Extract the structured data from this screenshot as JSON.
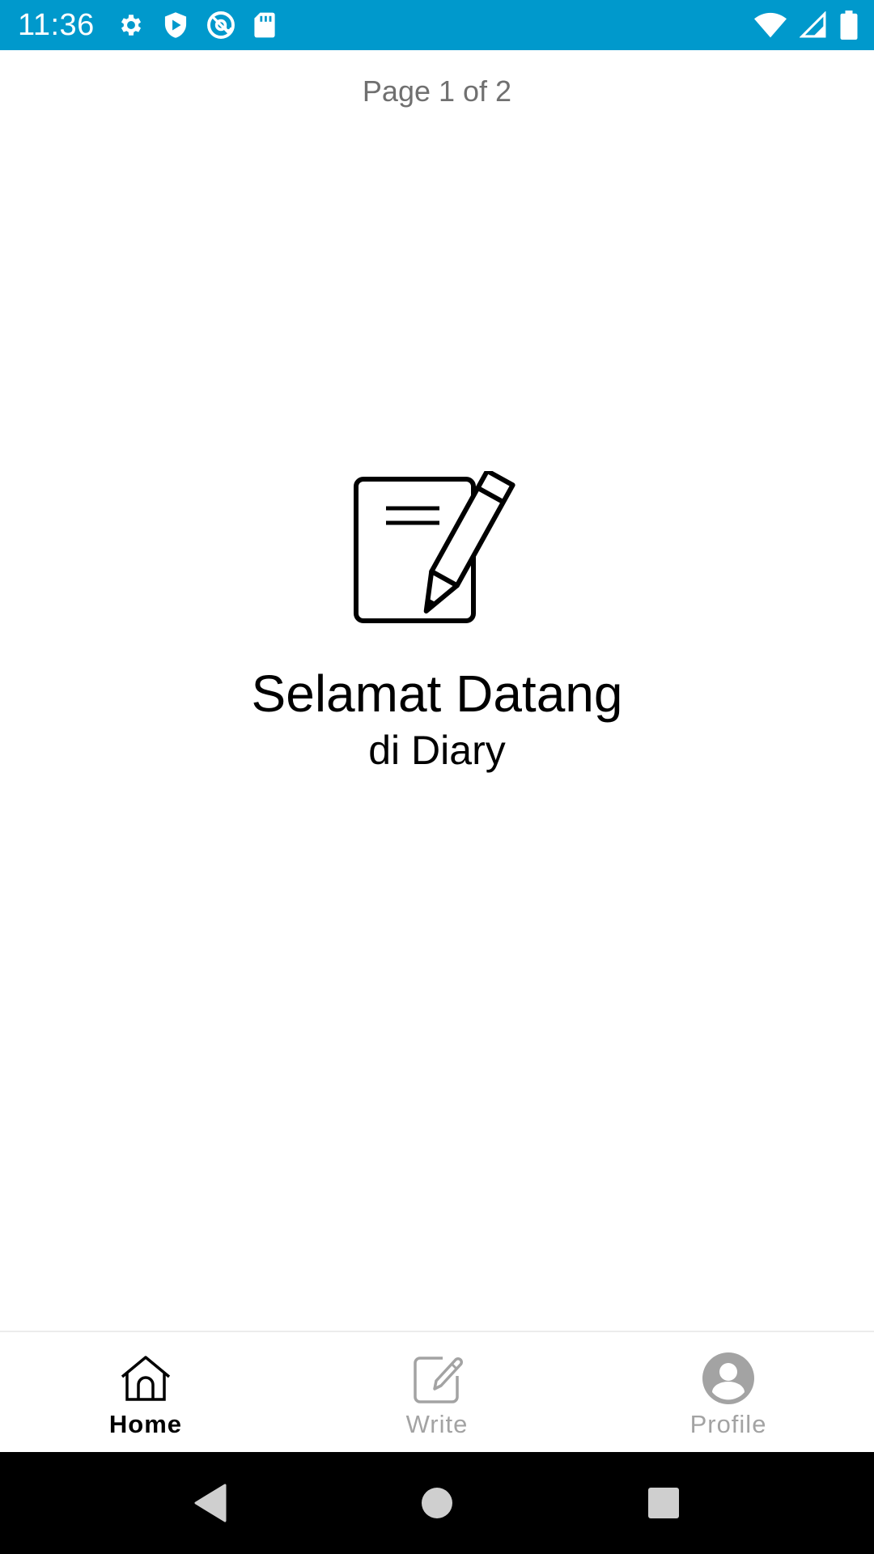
{
  "status_bar": {
    "time": "11:36",
    "background": "#0099cc",
    "left_icons": [
      "settings-icon",
      "shield-play-icon",
      "at-sign-icon",
      "sd-card-icon"
    ],
    "right_icons": [
      "wifi-icon",
      "cell-signal-icon",
      "battery-icon"
    ]
  },
  "pager": {
    "label": "Page 1 of 2"
  },
  "welcome": {
    "icon": "notepad-pencil-icon",
    "title": "Selamat Datang",
    "subtitle": "di Diary"
  },
  "bottom_nav": {
    "items": [
      {
        "label": "Home",
        "icon": "home-icon",
        "active": true
      },
      {
        "label": "Write",
        "icon": "edit-icon",
        "active": false
      },
      {
        "label": "Profile",
        "icon": "profile-icon",
        "active": false
      }
    ],
    "active_color": "#000000",
    "inactive_color": "#a3a3a3"
  },
  "system_nav": {
    "buttons": [
      "back-icon",
      "home-circle-icon",
      "recents-icon"
    ]
  }
}
